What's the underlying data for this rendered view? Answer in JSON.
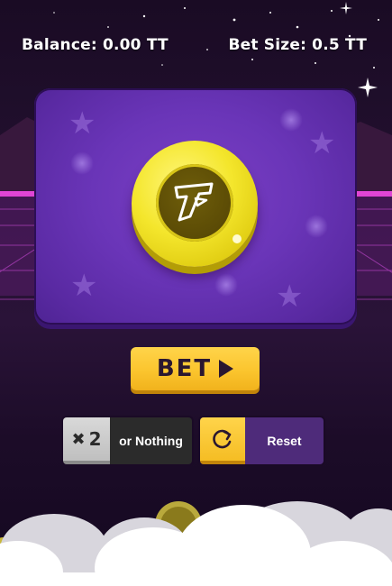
{
  "hud": {
    "balance_text": "Balance: 0.00 TT",
    "bet_size_text": "Bet Size: 0.5 TT"
  },
  "coin": {
    "emblem_icon": "lightning-t-logo-icon"
  },
  "actions": {
    "bet_label": "BET",
    "double_multiplier": "2",
    "double_label": "or Nothing",
    "reset_label": "Reset"
  },
  "colors": {
    "accent_yellow": "#FBC52E",
    "card_purple": "#6A35B8",
    "reset_purple": "#4E2B7A",
    "coin_gold": "#F4E62C"
  }
}
